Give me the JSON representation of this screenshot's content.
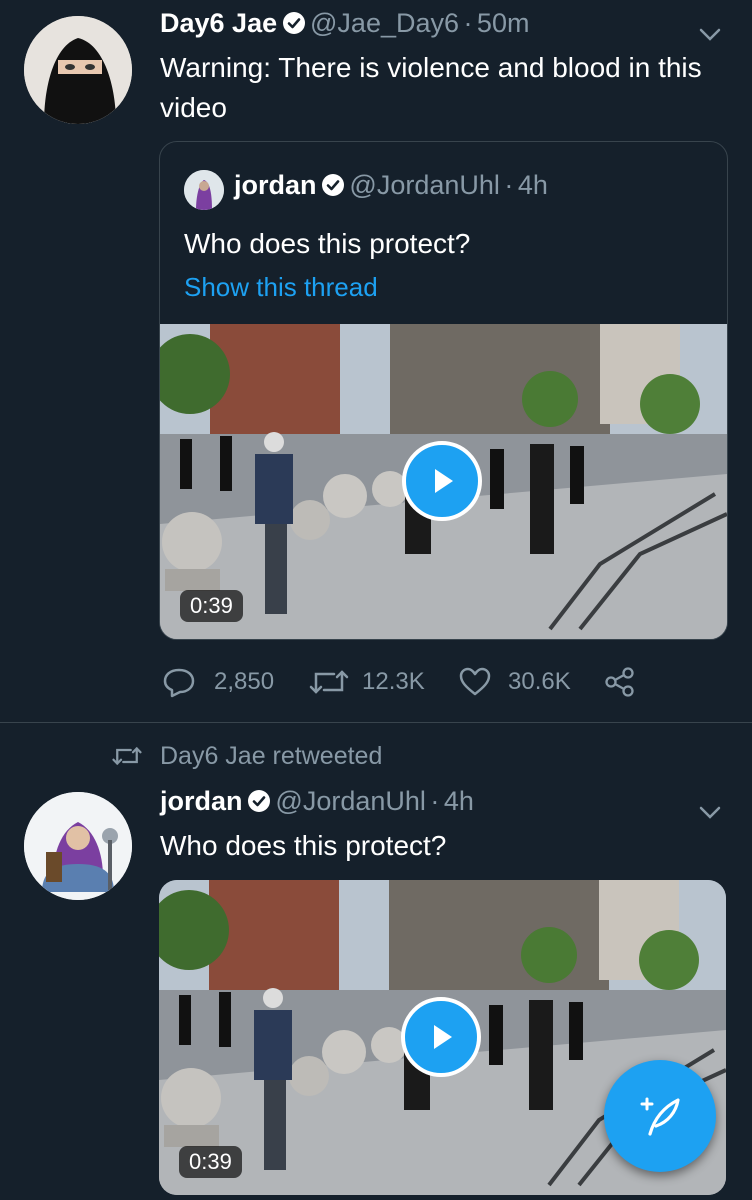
{
  "tweet1": {
    "display_name": "Day6 Jae",
    "handle": "@Jae_Day6",
    "time_sep": "·",
    "time": "50m",
    "text": "Warning: There is violence and blood in this video",
    "quoted": {
      "display_name": "jordan",
      "handle": "@JordanUhl",
      "time_sep": "·",
      "time": "4h",
      "text": "Who does this protect?",
      "show_thread": "Show this thread",
      "video_duration": "0:39"
    },
    "actions": {
      "replies": "2,850",
      "retweets": "12.3K",
      "likes": "30.6K"
    }
  },
  "tweet2": {
    "retweeted_by": "Day6 Jae retweeted",
    "display_name": "jordan",
    "handle": "@JordanUhl",
    "time_sep": "·",
    "time": "4h",
    "text": "Who does this protect?",
    "video_duration": "0:39"
  },
  "colors": {
    "background": "#15202b",
    "accent": "#1da1f2",
    "secondary_text": "#8899a6",
    "border": "#38444d"
  },
  "icons": [
    "verified-badge-icon",
    "chevron-down-icon",
    "reply-icon",
    "retweet-icon",
    "like-icon",
    "share-icon",
    "play-icon",
    "compose-tweet-icon"
  ]
}
